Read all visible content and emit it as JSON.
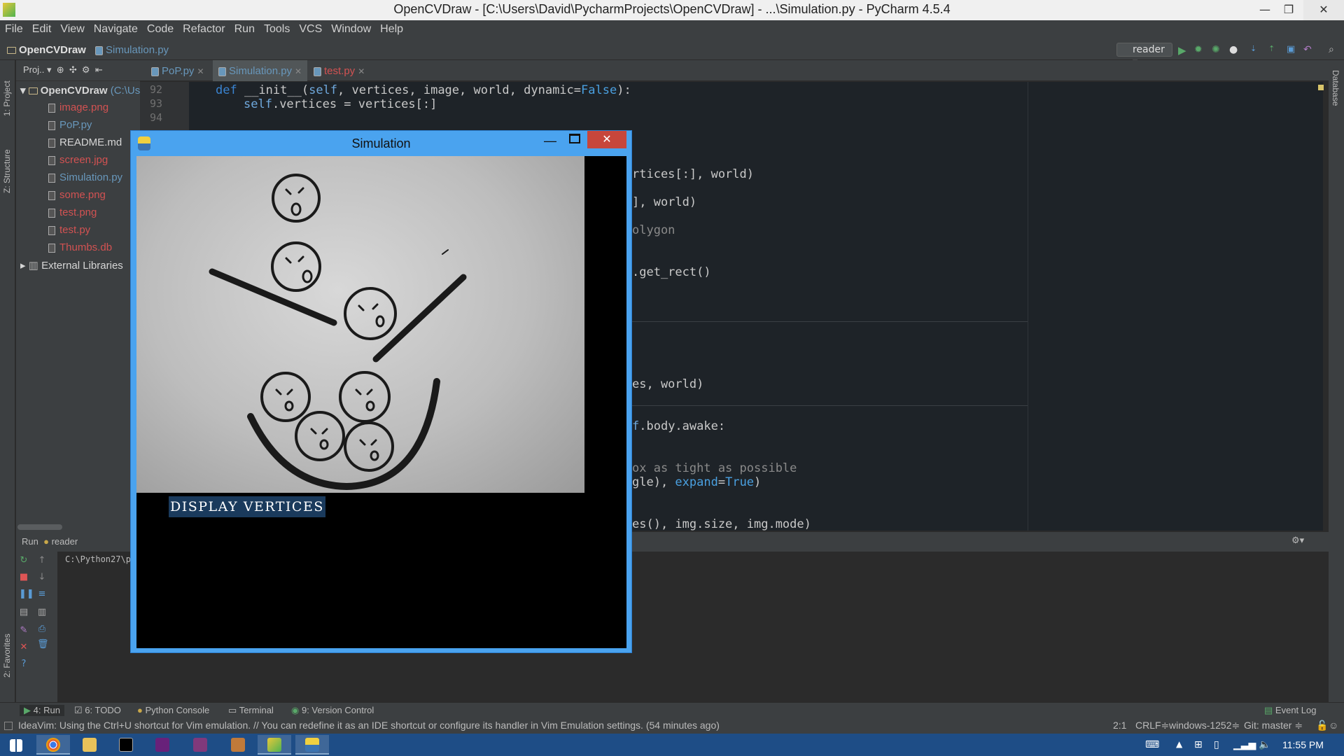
{
  "window": {
    "title": "OpenCVDraw - [C:\\Users\\David\\PycharmProjects\\OpenCVDraw] - ...\\Simulation.py - PyCharm 4.5.4",
    "controls": {
      "minimize": "—",
      "maximize": "❐",
      "close": "✕"
    }
  },
  "menu": [
    "File",
    "Edit",
    "View",
    "Navigate",
    "Code",
    "Refactor",
    "Run",
    "Tools",
    "VCS",
    "Window",
    "Help"
  ],
  "nav": {
    "project": "OpenCVDraw",
    "file": "Simulation.py",
    "run_config": "reader"
  },
  "left_tools": {
    "project": "1: Project",
    "structure": "Z: Structure",
    "favorites": "2: Favorites"
  },
  "right_tools": {
    "database": "Database"
  },
  "project_panel": {
    "header": "Proj..",
    "root": "OpenCVDraw",
    "root_path": "(C:\\Us",
    "files": [
      {
        "name": "image.png",
        "color": "red"
      },
      {
        "name": "PoP.py",
        "color": "blue"
      },
      {
        "name": "README.md",
        "color": "white"
      },
      {
        "name": "screen.jpg",
        "color": "red"
      },
      {
        "name": "Simulation.py",
        "color": "blue"
      },
      {
        "name": "some.png",
        "color": "red"
      },
      {
        "name": "test.png",
        "color": "red"
      },
      {
        "name": "test.py",
        "color": "red"
      },
      {
        "name": "Thumbs.db",
        "color": "red"
      }
    ],
    "external": "External Libraries"
  },
  "tabs": [
    {
      "label": "PoP.py",
      "active": false
    },
    {
      "label": "Simulation.py",
      "active": true
    },
    {
      "label": "test.py",
      "active": false
    }
  ],
  "editor": {
    "line_numbers": [
      "92",
      "93",
      "94"
    ],
    "l92_def": "def",
    "l92_name": " __init__(",
    "l92_self": "self",
    "l92_args": ", vertices, image, world, dynamic=",
    "l92_false": "False",
    "l92_end": "):",
    "l93_self": "self",
    "l93_rest": ".vertices = vertices[:]",
    "frag1": "rtices[:], world)",
    "frag2": "], world)",
    "frag3": "olygon",
    "frag4": ".get_rect()",
    "frag5": "es, world)",
    "frag6a": "f",
    "frag6b": ".body.awake:",
    "frag7": "ox as tight as possible",
    "frag8a": "gle), ",
    "frag8b": "expand",
    "frag8c": "=",
    "frag8d": "True",
    "frag8e": ")",
    "frag9": "es(), img.size, img.mode)"
  },
  "run": {
    "label": "Run",
    "config": "reader",
    "output": "C:\\Python27\\p"
  },
  "tool_windows": [
    "4: Run",
    "6: TODO",
    "Python Console",
    "Terminal",
    "9: Version Control",
    "Event Log"
  ],
  "status": {
    "message": "IdeaVim: Using the Ctrl+U shortcut for Vim emulation. // You can redefine it as an IDE shortcut or configure its handler in Vim Emulation settings. (54 minutes ago)",
    "position": "2:1",
    "line_sep": "CRLF≑",
    "encoding": "windows-1252≑",
    "git": "Git: master ≑"
  },
  "taskbar": {
    "clock": "11:55 PM"
  },
  "simulation": {
    "title": "Simulation",
    "button": "DISPLAY VERTICES"
  }
}
